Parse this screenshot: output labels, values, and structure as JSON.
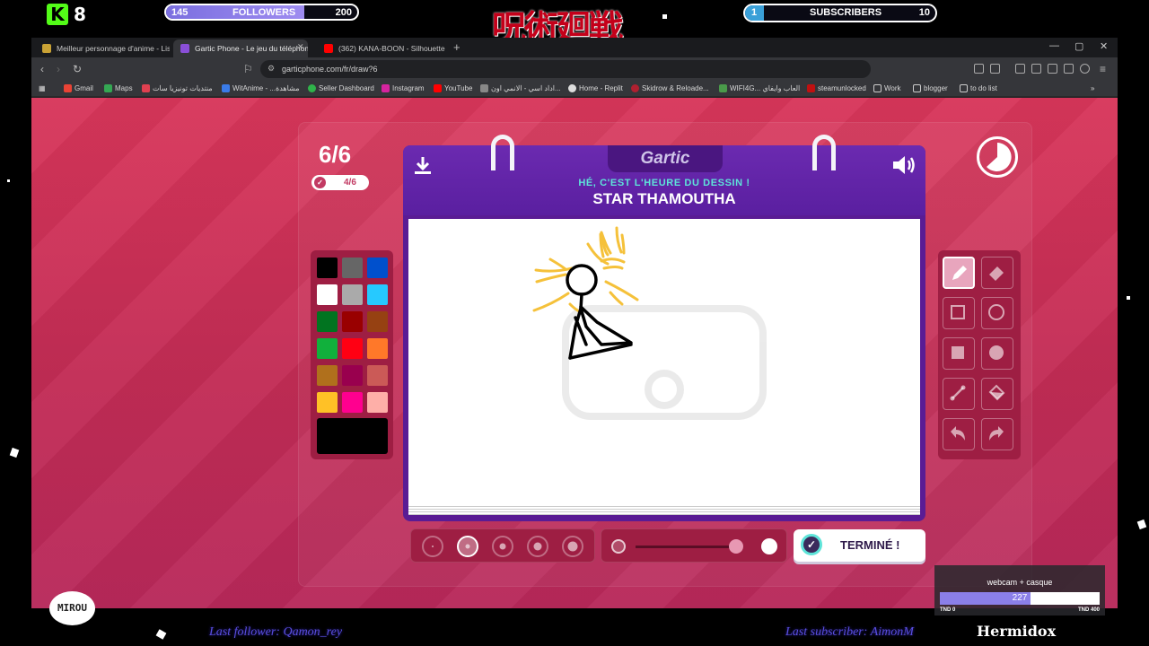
{
  "overlay": {
    "kick_count": "8",
    "followers": {
      "current": "145",
      "label": "FOLLOWERS",
      "goal": "200",
      "progress": 0.725
    },
    "subscribers": {
      "current": "1",
      "label": "SUBSCRIBERS",
      "goal": "10",
      "progress": 0.1
    },
    "title_jp": "呪術廻戦"
  },
  "browser": {
    "tabs": [
      {
        "label": "Meilleur personnage d'anime - Liste",
        "active": false
      },
      {
        "label": "Gartic Phone - Le jeu du téléphone",
        "active": true
      },
      {
        "label": "(362) KANA-BOON - Silhouette",
        "active": false
      }
    ],
    "url": "garticphone.com/fr/draw?6",
    "bookmarks": [
      "Gmail",
      "Maps",
      "منتديات تونيزيا سات",
      "WitAnime - ...مشاهدة",
      "Seller Dashboard",
      "Instagram",
      "YouTube",
      "اداد اسي - الانمي اون...",
      "Home - Replit",
      "Skidrow & Reloade...",
      "WIFI4G... العاب وايفاي",
      "steamunlocked",
      "Work",
      "blogger",
      "to do list"
    ]
  },
  "game": {
    "round": "6/6",
    "done_count": "4/6",
    "logo": "Gartic",
    "subtitle": "HÉ, C'EST L'HEURE DU DESSIN !",
    "prompt": "STAR THAMOUTHA",
    "done_label": "TERMINÉ !",
    "palette": [
      "#000000",
      "#666666",
      "#0050cd",
      "#ffffff",
      "#aaaaaa",
      "#26c9ff",
      "#017420",
      "#990000",
      "#964112",
      "#11b03c",
      "#ff0013",
      "#ff7829",
      "#b0701c",
      "#99004e",
      "#cb5a57",
      "#ffc126",
      "#ff008f",
      "#feafa8"
    ],
    "current_color": "#000000",
    "selected_tool": "pencil",
    "brush_size_index": 1,
    "opacity": 0.8
  },
  "sub_goal": {
    "label": "webcam + casque",
    "value": "227",
    "min": "TND 0",
    "max": "TND 400",
    "progress": 0.5675
  },
  "ticker": {
    "follower": "Last follower: Qamon_rey",
    "subscriber": "Last subscriber: AimonM"
  },
  "brand": "Hermidox",
  "mirou": "MIROU"
}
